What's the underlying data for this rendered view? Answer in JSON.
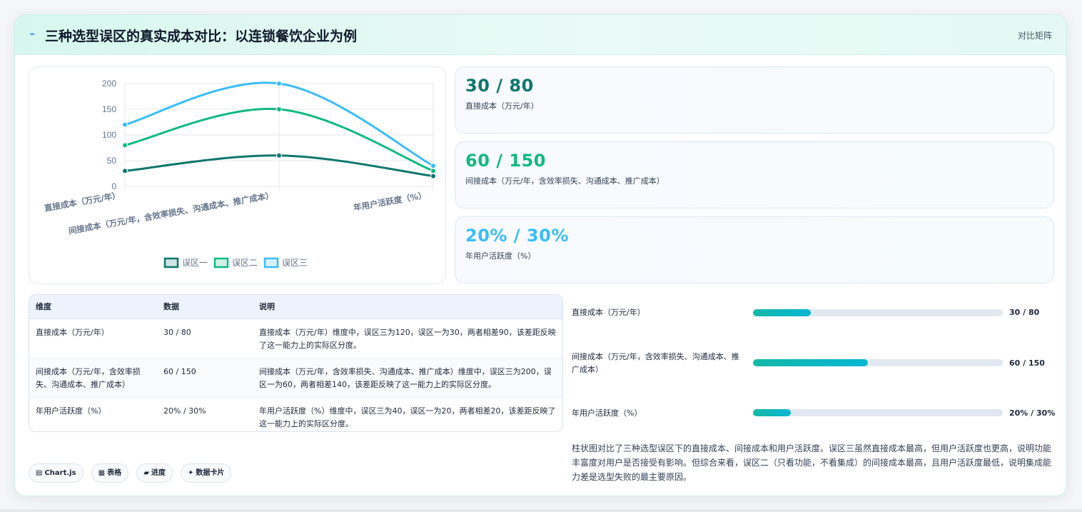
{
  "header": {
    "icon": "lightning-icon",
    "title": "三种选型误区的真实成本对比：以连锁餐饮企业为例",
    "tag": "对比矩阵"
  },
  "chart_data": {
    "type": "line",
    "categories": [
      "直接成本（万元/年）",
      "间接成本（万元/年，含效率损失、沟通成本、推广成本）",
      "年用户活跃度（%）"
    ],
    "series": [
      {
        "name": "误区一",
        "values": [
          30,
          60,
          20
        ],
        "color": "#0f766e"
      },
      {
        "name": "误区二",
        "values": [
          80,
          150,
          30
        ],
        "color": "#10b981"
      },
      {
        "name": "误区三",
        "values": [
          120,
          200,
          40
        ],
        "color": "#38bdf8"
      }
    ],
    "ylim": [
      0,
      200
    ],
    "yticks": [
      "0",
      "50",
      "100",
      "150",
      "200"
    ],
    "grid": true,
    "legend_position": "bottom"
  },
  "stats": [
    {
      "value": "30 / 80",
      "label": "直接成本（万元/年）",
      "color": "#0f766e"
    },
    {
      "value": "60 / 150",
      "label": "间接成本（万元/年，含效率损失、沟通成本、推广成本）",
      "color": "#10b981"
    },
    {
      "value": "20% / 30%",
      "label": "年用户活跃度（%）",
      "color": "#38bdf8"
    }
  ],
  "table": {
    "headers": [
      "维度",
      "数据",
      "说明"
    ],
    "rows": [
      [
        "直接成本（万元/年）",
        "30 / 80",
        "直接成本（万元/年）维度中，误区三为120，误区一为30，两者相差90，该差距反映了这一能力上的实际区分度。"
      ],
      [
        "间接成本（万元/年，含效率损失、沟通成本、推广成本）",
        "60 / 150",
        "间接成本（万元/年，含效率损失、沟通成本、推广成本）维度中，误区三为200，误区一为60，两者相差140，该差距反映了这一能力上的实际区分度。"
      ],
      [
        "年用户活跃度（%）",
        "20% / 30%",
        "年用户活跃度（%）维度中，误区三为40，误区一为20，两者相差20，该差距反映了这一能力上的实际区分度。"
      ]
    ]
  },
  "progress": [
    {
      "label": "直接成本（万元/年）",
      "value": "30 / 80",
      "fill": 0.23
    },
    {
      "label": "间接成本（万元/年，含效率损失、沟通成本、推广成本）",
      "value": "60 / 150",
      "fill": 0.46
    },
    {
      "label": "年用户活跃度（%）",
      "value": "20% / 30%",
      "fill": 0.15
    }
  ],
  "summary": "柱状图对比了三种选型误区下的直接成本、间接成本和用户活跃度。误区三虽然直接成本最高，但用户活跃度也更高，说明功能丰富度对用户是否接受有影响。但综合来看，误区二（只看功能，不看集成）的间接成本最高，且用户活跃度最低，说明集成能力差是选型失败的最主要原因。",
  "chips": [
    {
      "icon": "chart-icon",
      "label": "Chart.js"
    },
    {
      "icon": "table-icon",
      "label": "表格"
    },
    {
      "icon": "progress-icon",
      "label": "进度"
    },
    {
      "icon": "sparkle-icon",
      "label": "数据卡片"
    }
  ]
}
